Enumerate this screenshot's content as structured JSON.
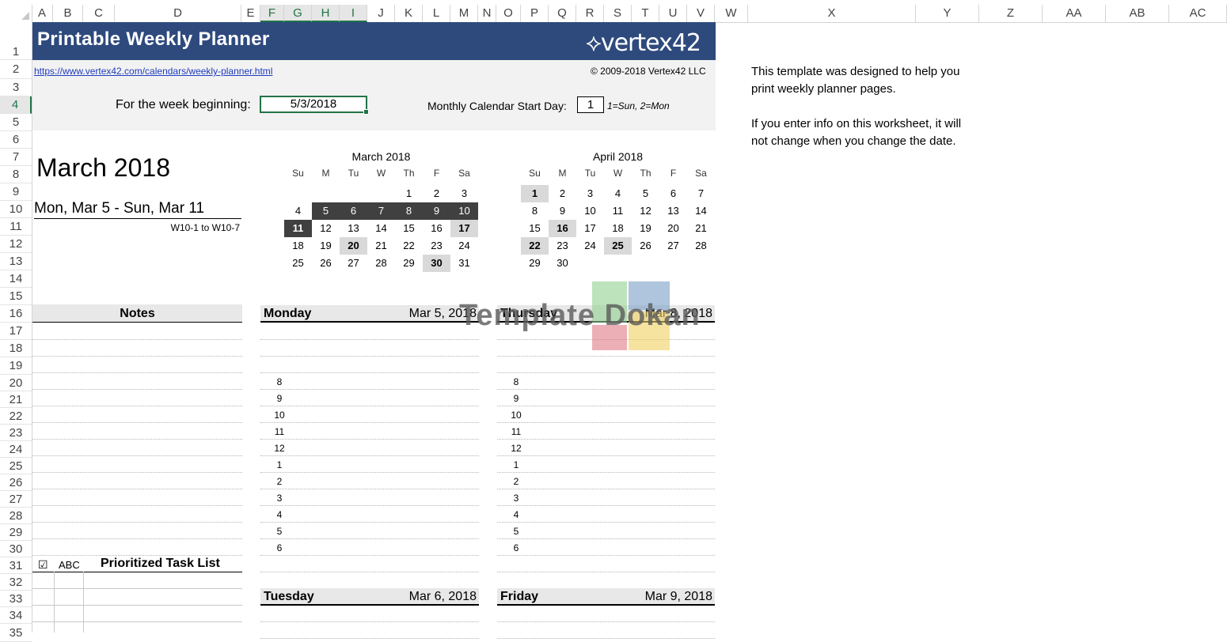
{
  "columns": [
    "A",
    "B",
    "C",
    "D",
    "E",
    "F",
    "G",
    "H",
    "I",
    "J",
    "K",
    "L",
    "M",
    "N",
    "O",
    "P",
    "Q",
    "R",
    "S",
    "T",
    "U",
    "V",
    "W",
    "X",
    "Y",
    "Z",
    "AA",
    "AB",
    "AC"
  ],
  "rows": [
    "1",
    "2",
    "3",
    "4",
    "5",
    "6",
    "7",
    "8",
    "9",
    "10",
    "11",
    "12",
    "13",
    "14",
    "15",
    "16",
    "17",
    "18",
    "19",
    "20",
    "21",
    "22",
    "23",
    "24",
    "25",
    "26",
    "27",
    "28",
    "29",
    "30",
    "31",
    "32",
    "33",
    "34",
    "35"
  ],
  "header": {
    "title": "Printable Weekly Planner",
    "logo_text": "vertex42",
    "link": "https://www.vertex42.com/calendars/weekly-planner.html",
    "copyright": "© 2009-2018 Vertex42 LLC"
  },
  "inputs": {
    "week_label": "For the week beginning:",
    "week_value": "5/3/2018",
    "start_label": "Monthly Calendar Start Day:",
    "start_value": "1",
    "start_hint": "1=Sun, 2=Mon"
  },
  "summary": {
    "month": "March 2018",
    "range": "Mon, Mar 5  -  Sun, Mar 11",
    "week_code": "W10-1 to W10-7"
  },
  "calendars": [
    {
      "title": "March 2018",
      "weekdays": [
        "Su",
        "M",
        "Tu",
        "W",
        "Th",
        "F",
        "Sa"
      ],
      "weeks": [
        [
          "",
          "",
          "",
          "",
          "1",
          "2",
          "3"
        ],
        [
          "4",
          "5",
          "6",
          "7",
          "8",
          "9",
          "10"
        ],
        [
          "11",
          "12",
          "13",
          "14",
          "15",
          "16",
          "17"
        ],
        [
          "18",
          "19",
          "20",
          "21",
          "22",
          "23",
          "24"
        ],
        [
          "25",
          "26",
          "27",
          "28",
          "29",
          "30",
          "31"
        ]
      ]
    },
    {
      "title": "April 2018",
      "weekdays": [
        "Su",
        "M",
        "Tu",
        "W",
        "Th",
        "F",
        "Sa"
      ],
      "weeks": [
        [
          "1",
          "2",
          "3",
          "4",
          "5",
          "6",
          "7"
        ],
        [
          "8",
          "9",
          "10",
          "11",
          "12",
          "13",
          "14"
        ],
        [
          "15",
          "16",
          "17",
          "18",
          "19",
          "20",
          "21"
        ],
        [
          "22",
          "23",
          "24",
          "25",
          "26",
          "27",
          "28"
        ],
        [
          "29",
          "30",
          "",
          "",
          "",
          "",
          ""
        ]
      ]
    }
  ],
  "notes_header": "Notes",
  "tasks": {
    "check": "☑",
    "abc": "ABC",
    "header": "Prioritized Task List"
  },
  "days": [
    {
      "name": "Monday",
      "date": "Mar 5, 2018"
    },
    {
      "name": "Thursday",
      "date": "Mar 8, 2018"
    },
    {
      "name": "Tuesday",
      "date": "Mar 6, 2018"
    },
    {
      "name": "Friday",
      "date": "Mar 9, 2018"
    }
  ],
  "hours": [
    "8",
    "9",
    "10",
    "11",
    "12",
    "1",
    "2",
    "3",
    "4",
    "5",
    "6"
  ],
  "side_note": {
    "para1": "This template was designed to help you print weekly planner pages.",
    "para2": "If you enter info on this worksheet, it will not change when you change the date."
  },
  "watermark": "Template Dokan",
  "colors": {
    "title_bar": "#2e4a7d",
    "selection": "#217346",
    "dark_cell": "#404040",
    "gray_cell": "#d9d9d9"
  }
}
